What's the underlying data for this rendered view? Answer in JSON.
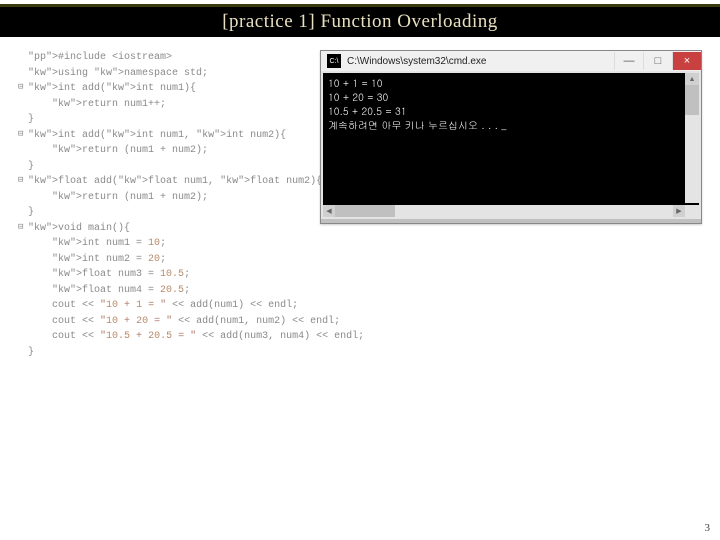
{
  "title": "[practice 1] Function Overloading",
  "code_lines": [
    {
      "gutter": "",
      "text": "#include <iostream>",
      "cls": "pp"
    },
    {
      "gutter": "",
      "text": "using namespace std;",
      "cls": ""
    },
    {
      "gutter": "",
      "text": "",
      "cls": ""
    },
    {
      "gutter": "⊟",
      "text": "int add(int num1){",
      "cls": ""
    },
    {
      "gutter": "",
      "text": "    return num1++;",
      "cls": ""
    },
    {
      "gutter": "",
      "text": "}",
      "cls": ""
    },
    {
      "gutter": "",
      "text": "",
      "cls": ""
    },
    {
      "gutter": "⊟",
      "text": "int add(int num1, int num2){",
      "cls": ""
    },
    {
      "gutter": "",
      "text": "    return (num1 + num2);",
      "cls": ""
    },
    {
      "gutter": "",
      "text": "}",
      "cls": ""
    },
    {
      "gutter": "",
      "text": "",
      "cls": ""
    },
    {
      "gutter": "⊟",
      "text": "float add(float num1, float num2){",
      "cls": ""
    },
    {
      "gutter": "",
      "text": "    return (num1 + num2);",
      "cls": ""
    },
    {
      "gutter": "",
      "text": "}",
      "cls": ""
    },
    {
      "gutter": "",
      "text": "",
      "cls": ""
    },
    {
      "gutter": "⊟",
      "text": "void main(){",
      "cls": ""
    },
    {
      "gutter": "",
      "text": "    int num1 = 10;",
      "cls": ""
    },
    {
      "gutter": "",
      "text": "    int num2 = 20;",
      "cls": ""
    },
    {
      "gutter": "",
      "text": "    float num3 = 10.5;",
      "cls": ""
    },
    {
      "gutter": "",
      "text": "    float num4 = 20.5;",
      "cls": ""
    },
    {
      "gutter": "",
      "text": "",
      "cls": ""
    },
    {
      "gutter": "",
      "text": "    cout << \"10 + 1 = \" << add(num1) << endl;",
      "cls": ""
    },
    {
      "gutter": "",
      "text": "    cout << \"10 + 20 = \" << add(num1, num2) << endl;",
      "cls": ""
    },
    {
      "gutter": "",
      "text": "    cout << \"10.5 + 20.5 = \" << add(num3, num4) << endl;",
      "cls": ""
    },
    {
      "gutter": "",
      "text": "}",
      "cls": ""
    }
  ],
  "cmd": {
    "title": "C:\\Windows\\system32\\cmd.exe",
    "output": [
      "10 + 1 = 10",
      "10 + 20 = 30",
      "10.5 + 20.5 = 31",
      "계속하려면 아무 키나 누르십시오 . . . _"
    ],
    "btn_min": "—",
    "btn_max": "□",
    "btn_close": "×"
  },
  "page_number": "3"
}
